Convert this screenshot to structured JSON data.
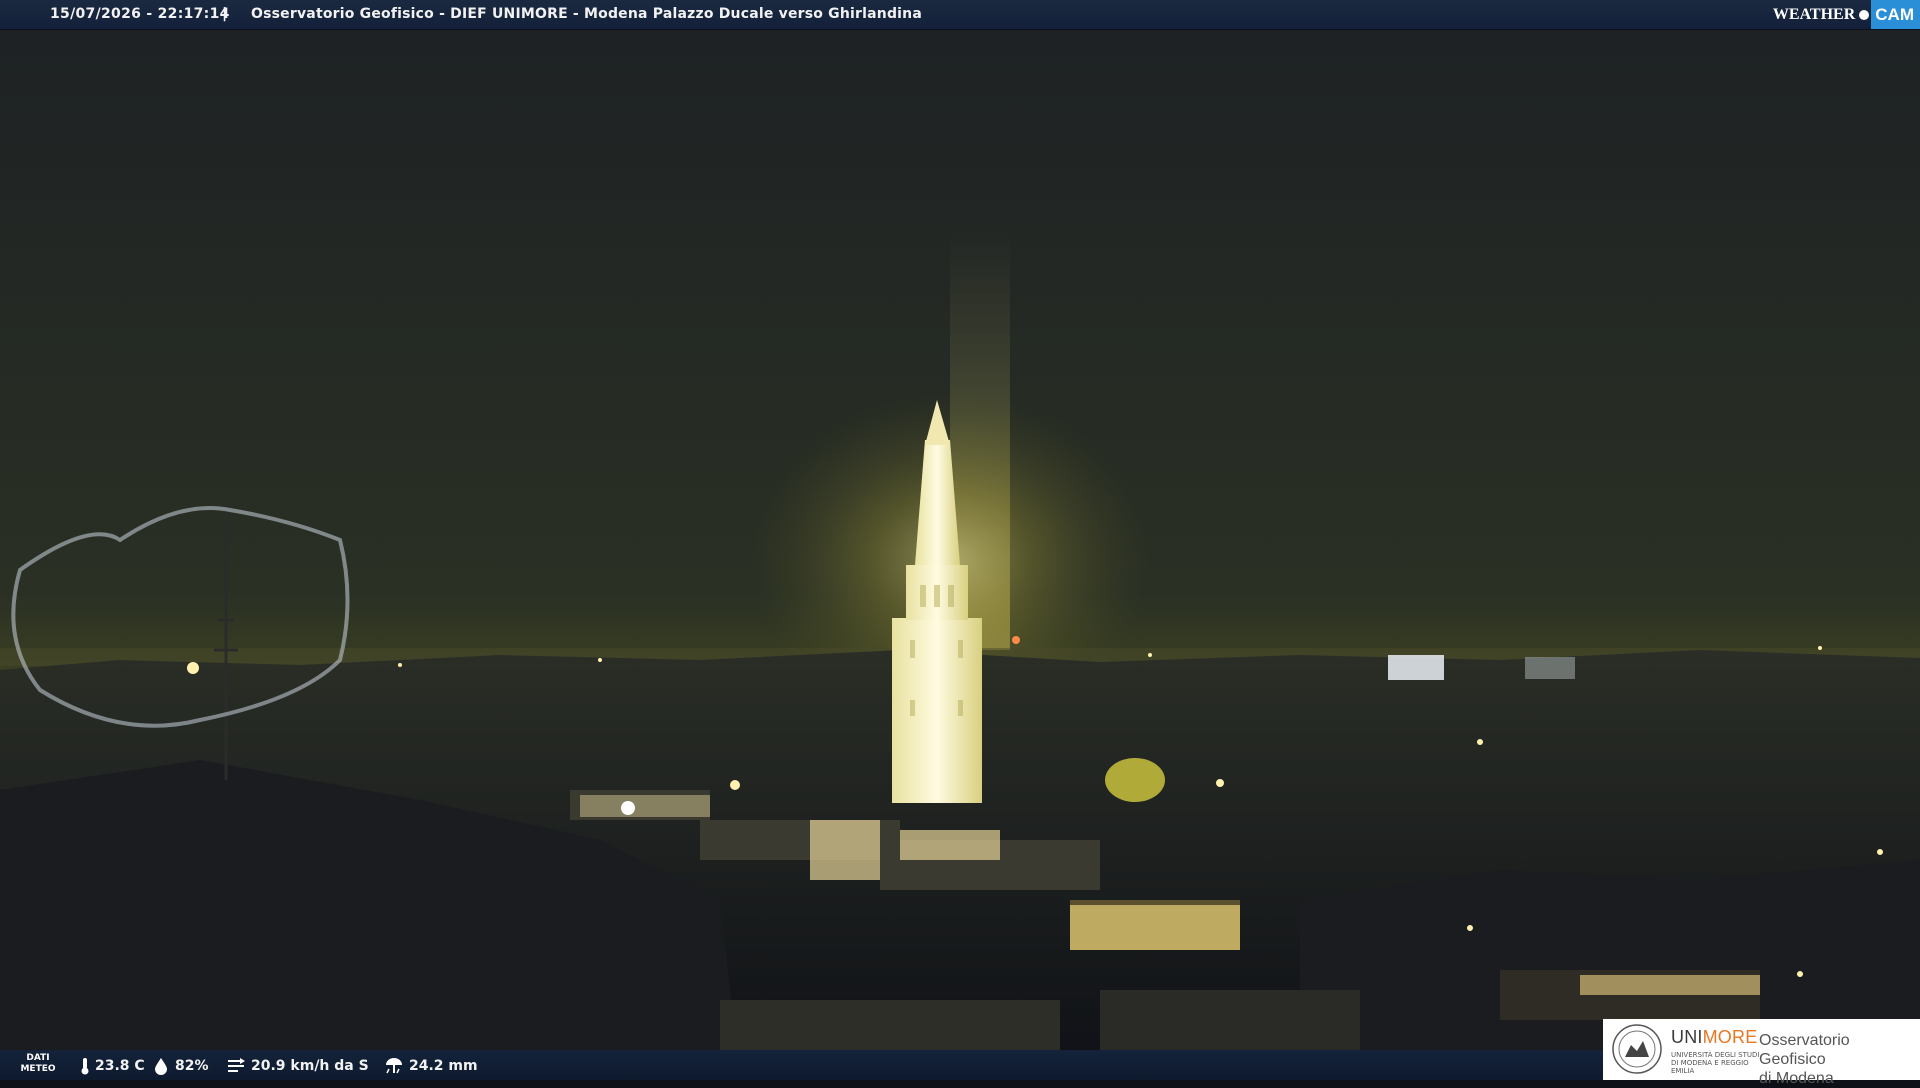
{
  "header": {
    "timestamp": "15/07/2026 - 22:17:14",
    "separator": "|",
    "title": "Osservatorio Geofisico - DIEF UNIMORE - Modena Palazzo Ducale verso Ghirlandina"
  },
  "brand": {
    "weather_text": "WEATHER",
    "cam_text": "CAM",
    "accent_color": "#2a8fd6"
  },
  "weather": {
    "label_line1": "DATI",
    "label_line2": "METEO",
    "temperature": "23.8 C",
    "humidity": "82%",
    "wind": "20.9 km/h da S",
    "rain": "24.2 mm",
    "icons": [
      "thermometer-icon",
      "humidity-drop-icon",
      "wind-icon",
      "rain-icon"
    ]
  },
  "logo": {
    "uni_part1": "UNI",
    "uni_part2": "MORE",
    "uni_sub": "UNIVERSITÀ DEGLI STUDI DI MODENA E REGGIO EMILIA",
    "obs_line1": "Osservatorio Geofisico",
    "obs_line2": "di Modena",
    "accent_color": "#e87722"
  }
}
